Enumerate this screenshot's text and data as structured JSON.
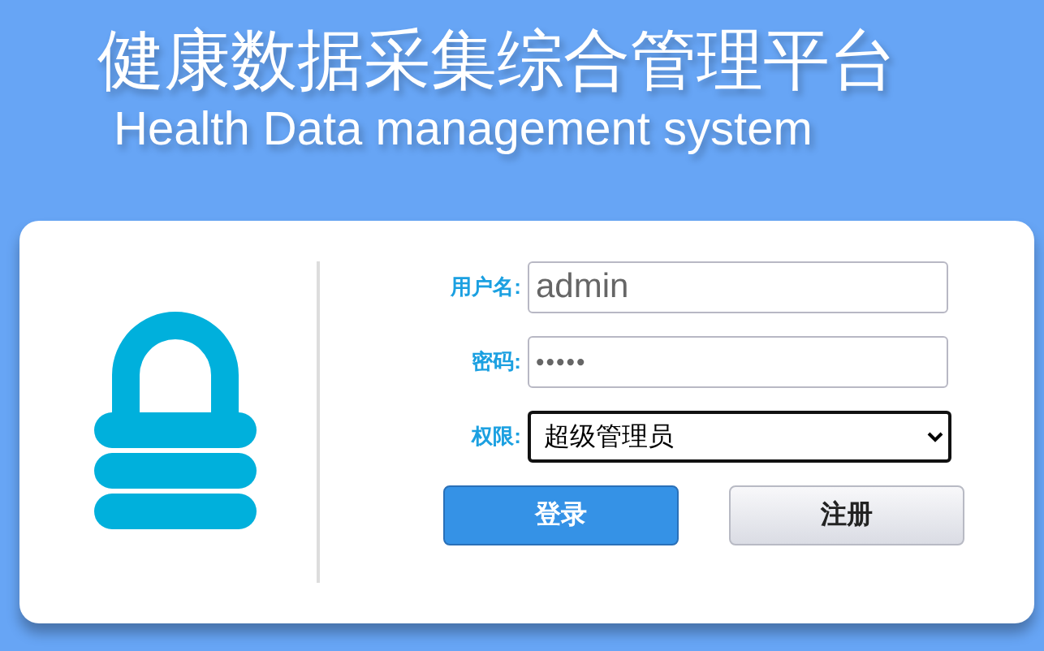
{
  "title": "健康数据采集综合管理平台",
  "subtitle": "Health Data management system",
  "form": {
    "fields": [
      {
        "kind": "text",
        "label": "用户名:",
        "value": "admin"
      },
      {
        "kind": "password",
        "label": "密码:",
        "value": "•••••"
      },
      {
        "kind": "select",
        "label": "权限:",
        "value": "超级管理员"
      }
    ],
    "buttons": [
      {
        "kind": "primary",
        "label": "登录"
      },
      {
        "kind": "secondary",
        "label": "注册"
      }
    ]
  }
}
